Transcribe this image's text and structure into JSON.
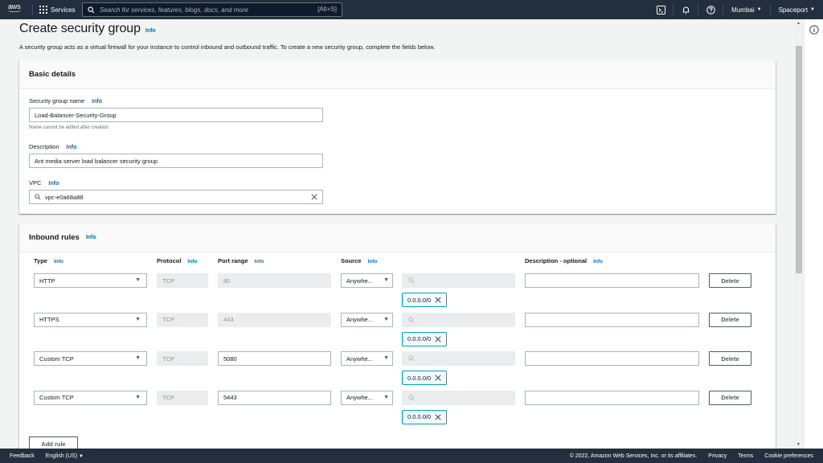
{
  "topnav": {
    "logo_text": "aws",
    "services_label": "Services",
    "search_placeholder": "Search for services, features, blogs, docs, and more",
    "search_shortcut": "[Alt+S]",
    "region": "Mumbai",
    "account": "Spaceport",
    "icons": [
      "cloudshell-icon",
      "bell-icon",
      "help-icon"
    ]
  },
  "page": {
    "title": "Create security group",
    "title_info": "Info",
    "description": "A security group acts as a virtual firewall for your instance to control inbound and outbound traffic. To create a new security group, complete the fields below."
  },
  "basic_details": {
    "title": "Basic details",
    "name_label": "Security group name",
    "name_info": "Info",
    "name_value": "Load-Balancer-Security-Group",
    "name_hint": "Name cannot be edited after creation.",
    "description_label": "Description",
    "description_info": "Info",
    "description_value": "Ant media server load balancer security group",
    "vpc_label": "VPC",
    "vpc_info": "Info",
    "vpc_value": "vpc-e0a68a88"
  },
  "inbound_rules": {
    "title": "Inbound rules",
    "title_info": "Info",
    "columns": {
      "type": "Type",
      "protocol": "Protocol",
      "port_range": "Port range",
      "source": "Source",
      "description": "Description - optional",
      "info": "Info"
    },
    "rows": [
      {
        "type": "HTTP",
        "protocol": "TCP",
        "port": "80",
        "port_editable": false,
        "source": "Anywhe...",
        "cidr": "0.0.0.0/0",
        "description": "",
        "delete_label": "Delete"
      },
      {
        "type": "HTTPS",
        "protocol": "TCP",
        "port": "443",
        "port_editable": false,
        "source": "Anywhe...",
        "cidr": "0.0.0.0/0",
        "description": "",
        "delete_label": "Delete"
      },
      {
        "type": "Custom TCP",
        "protocol": "TCP",
        "port": "5080",
        "port_editable": true,
        "source": "Anywhe...",
        "cidr": "0.0.0.0/0",
        "description": "",
        "delete_label": "Delete"
      },
      {
        "type": "Custom TCP",
        "protocol": "TCP",
        "port": "5443",
        "port_editable": true,
        "source": "Anywhe...",
        "cidr": "0.0.0.0/0",
        "description": "",
        "delete_label": "Delete"
      }
    ],
    "add_rule_label": "Add rule"
  },
  "footer": {
    "feedback": "Feedback",
    "language": "English (US)",
    "copyright": "© 2022, Amazon Web Services, Inc. or its affiliates.",
    "privacy": "Privacy",
    "terms": "Terms",
    "cookie_preferences": "Cookie preferences"
  },
  "colors": {
    "nav_bg": "#232f3e",
    "link": "#0073bb",
    "token_border": "#00a1c9",
    "page_bg": "#f2f3f3",
    "logo_accent": "#ff9900"
  }
}
